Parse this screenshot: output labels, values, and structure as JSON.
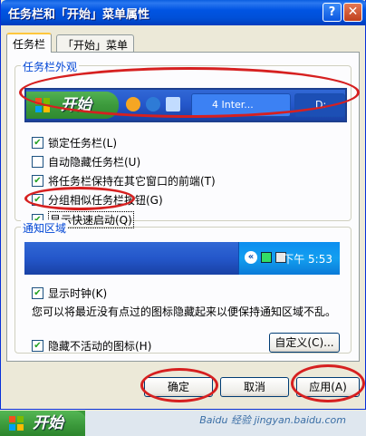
{
  "window": {
    "title": "任务栏和「开始」菜单属性",
    "help_label": "?",
    "close_label": "✕"
  },
  "tabs": [
    {
      "label": "任务栏"
    },
    {
      "label": "「开始」菜单"
    }
  ],
  "appearance": {
    "label": "任务栏外观",
    "start_label": "开始",
    "task_button_1": "4 Inter...",
    "task_button_2": "D:"
  },
  "options": [
    {
      "label": "锁定任务栏(L)",
      "checked": true
    },
    {
      "label": "自动隐藏任务栏(U)",
      "checked": false
    },
    {
      "label": "将任务栏保持在其它窗口的前端(T)",
      "checked": true
    },
    {
      "label": "分组相似任务栏按钮(G)",
      "checked": true
    },
    {
      "label": "显示快速启动(Q)",
      "checked": true
    }
  ],
  "notification": {
    "label": "通知区域",
    "clock": "下午 5:53",
    "show_clock": "显示时钟(K)",
    "description": "您可以将最近没有点过的图标隐藏起来以便保持通知区域不乱。",
    "hide_inactive": "隐藏不活动的图标(H)",
    "customize": "自定义(C)..."
  },
  "buttons": {
    "ok": "确定",
    "cancel": "取消",
    "apply": "应用(A)"
  },
  "bottom": {
    "start_label": "开始",
    "watermark": "Baidu 经验  jingyan.baidu.com"
  }
}
